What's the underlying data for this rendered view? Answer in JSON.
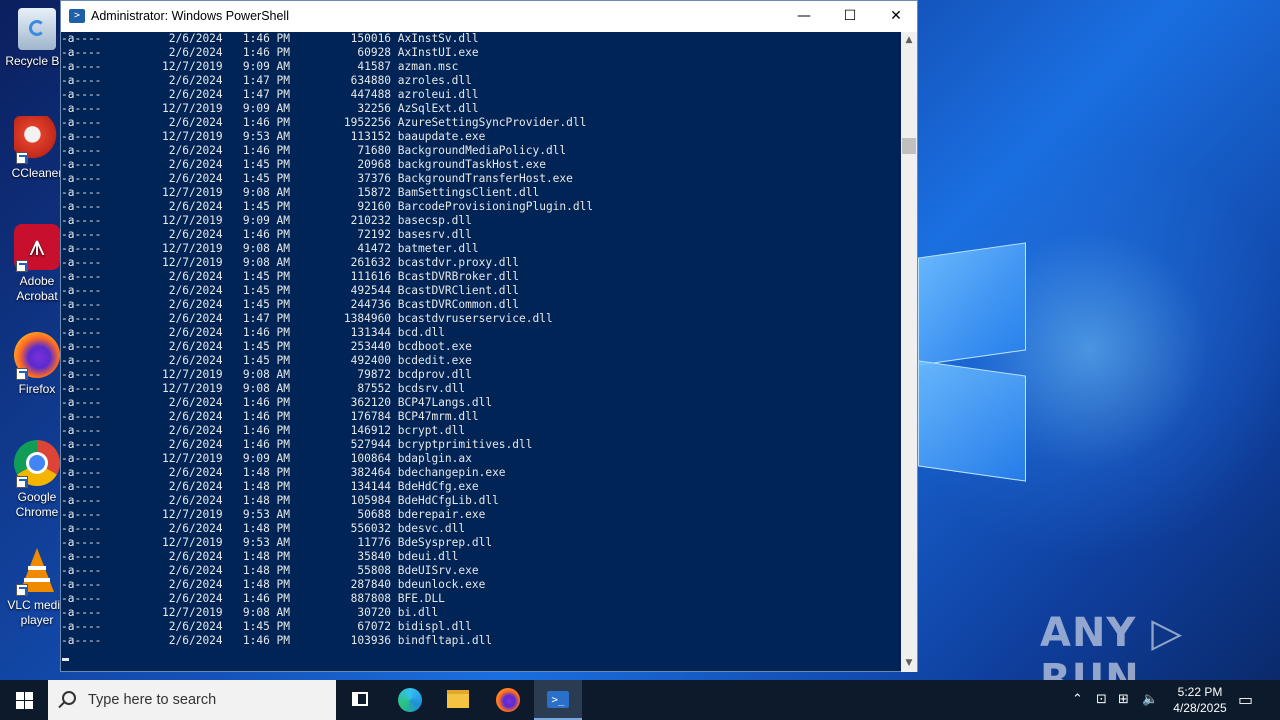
{
  "desktop": {
    "icons": [
      {
        "label": "Recycle Bin",
        "icon": "recycle-bin-icon"
      },
      {
        "label": "CCleaner",
        "icon": "ccleaner-icon"
      },
      {
        "label": "Adobe Acrobat",
        "icon": "adobe-acrobat-icon"
      },
      {
        "label": "Firefox",
        "icon": "firefox-icon"
      },
      {
        "label": "Google Chrome",
        "icon": "chrome-icon"
      },
      {
        "label": "VLC media player",
        "icon": "vlc-icon"
      }
    ],
    "watermark": "ANY ▷ RUN"
  },
  "window": {
    "title": "Administrator: Windows PowerShell",
    "minimize_glyph": "—",
    "maximize_glyph": "☐",
    "close_glyph": "✕"
  },
  "console": {
    "lines": [
      "-a----          2/6/2024   1:46 PM         150016 AxInstSv.dll",
      "-a----          2/6/2024   1:46 PM          60928 AxInstUI.exe",
      "-a----         12/7/2019   9:09 AM          41587 azman.msc",
      "-a----          2/6/2024   1:47 PM         634880 azroles.dll",
      "-a----          2/6/2024   1:47 PM         447488 azroleui.dll",
      "-a----         12/7/2019   9:09 AM          32256 AzSqlExt.dll",
      "-a----          2/6/2024   1:46 PM        1952256 AzureSettingSyncProvider.dll",
      "-a----         12/7/2019   9:53 AM         113152 baaupdate.exe",
      "-a----          2/6/2024   1:46 PM          71680 BackgroundMediaPolicy.dll",
      "-a----          2/6/2024   1:45 PM          20968 backgroundTaskHost.exe",
      "-a----          2/6/2024   1:45 PM          37376 BackgroundTransferHost.exe",
      "-a----         12/7/2019   9:08 AM          15872 BamSettingsClient.dll",
      "-a----          2/6/2024   1:45 PM          92160 BarcodeProvisioningPlugin.dll",
      "-a----         12/7/2019   9:09 AM         210232 basecsp.dll",
      "-a----          2/6/2024   1:46 PM          72192 basesrv.dll",
      "-a----         12/7/2019   9:08 AM          41472 batmeter.dll",
      "-a----         12/7/2019   9:08 AM         261632 bcastdvr.proxy.dll",
      "-a----          2/6/2024   1:45 PM         111616 BcastDVRBroker.dll",
      "-a----          2/6/2024   1:45 PM         492544 BcastDVRClient.dll",
      "-a----          2/6/2024   1:45 PM         244736 BcastDVRCommon.dll",
      "-a----          2/6/2024   1:47 PM        1384960 bcastdvruserservice.dll",
      "-a----          2/6/2024   1:46 PM         131344 bcd.dll",
      "-a----          2/6/2024   1:45 PM         253440 bcdboot.exe",
      "-a----          2/6/2024   1:45 PM         492400 bcdedit.exe",
      "-a----         12/7/2019   9:08 AM          79872 bcdprov.dll",
      "-a----         12/7/2019   9:08 AM          87552 bcdsrv.dll",
      "-a----          2/6/2024   1:46 PM         362120 BCP47Langs.dll",
      "-a----          2/6/2024   1:46 PM         176784 BCP47mrm.dll",
      "-a----          2/6/2024   1:46 PM         146912 bcrypt.dll",
      "-a----          2/6/2024   1:46 PM         527944 bcryptprimitives.dll",
      "-a----         12/7/2019   9:09 AM         100864 bdaplgin.ax",
      "-a----          2/6/2024   1:48 PM         382464 bdechangepin.exe",
      "-a----          2/6/2024   1:48 PM         134144 BdeHdCfg.exe",
      "-a----          2/6/2024   1:48 PM         105984 BdeHdCfgLib.dll",
      "-a----         12/7/2019   9:53 AM          50688 bderepair.exe",
      "-a----          2/6/2024   1:48 PM         556032 bdesvc.dll",
      "-a----         12/7/2019   9:53 AM          11776 BdeSysprep.dll",
      "-a----          2/6/2024   1:48 PM          35840 bdeui.dll",
      "-a----          2/6/2024   1:48 PM          55808 BdeUISrv.exe",
      "-a----          2/6/2024   1:48 PM         287840 bdeunlock.exe",
      "-a----          2/6/2024   1:46 PM         887808 BFE.DLL",
      "-a----         12/7/2019   9:08 AM          30720 bi.dll",
      "-a----          2/6/2024   1:45 PM          67072 bidispl.dll",
      "-a----          2/6/2024   1:46 PM         103936 bindfltapi.dll"
    ]
  },
  "taskbar": {
    "search_placeholder": "Type here to search",
    "apps": [
      "task-view-icon",
      "edge-icon",
      "file-explorer-icon",
      "firefox-icon",
      "powershell-icon"
    ],
    "clock_time": "5:22 PM",
    "clock_date": "4/28/2025"
  },
  "colors": {
    "console_bg": "#012456",
    "console_fg": "#e8e8e8",
    "taskbar_bg": "#0d1a2b"
  }
}
